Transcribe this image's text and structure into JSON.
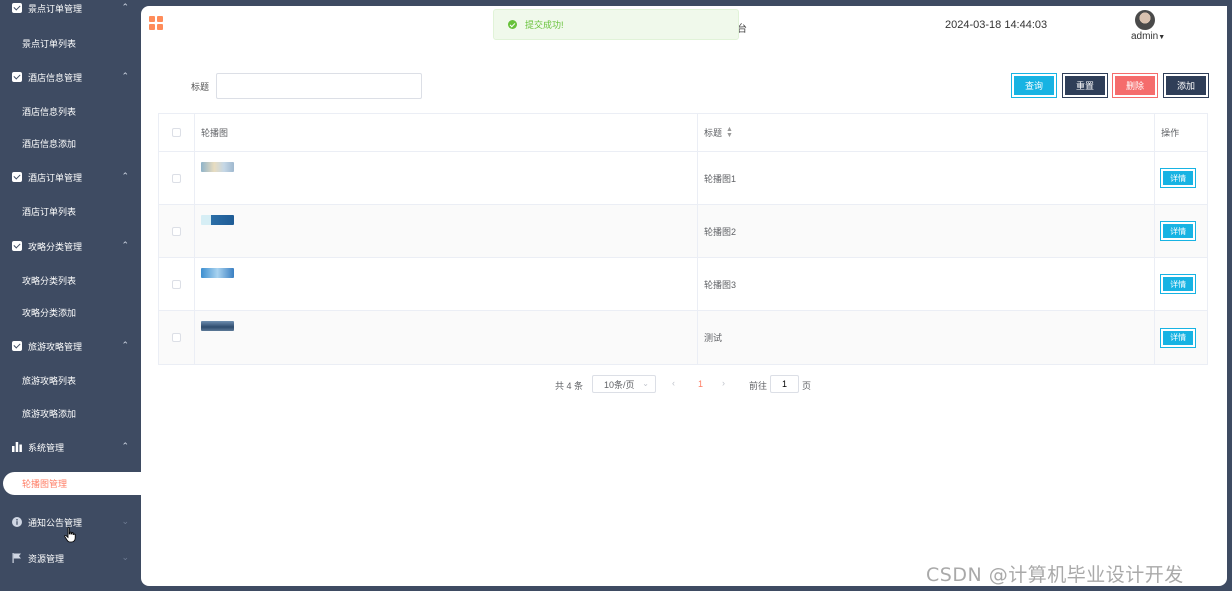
{
  "sidebar": {
    "groups": [
      {
        "label": "景点订单管理",
        "icon": "checkbox-icon"
      },
      {
        "label": "酒店信息管理",
        "icon": "checkbox-icon"
      },
      {
        "label": "酒店订单管理",
        "icon": "checkbox-icon"
      },
      {
        "label": "攻略分类管理",
        "icon": "checkbox-icon"
      },
      {
        "label": "旅游攻略管理",
        "icon": "checkbox-icon"
      },
      {
        "label": "系统管理",
        "icon": "bar-chart-icon"
      },
      {
        "label": "通知公告管理",
        "icon": "info-icon"
      },
      {
        "label": "资源管理",
        "icon": "flag-icon"
      }
    ],
    "items": [
      {
        "label": "景点订单列表"
      },
      {
        "label": "酒店信息列表"
      },
      {
        "label": "酒店信息添加"
      },
      {
        "label": "酒店订单列表"
      },
      {
        "label": "攻略分类列表"
      },
      {
        "label": "攻略分类添加"
      },
      {
        "label": "旅游攻略列表"
      },
      {
        "label": "旅游攻略添加"
      }
    ],
    "active_item": "轮播图管理"
  },
  "header": {
    "toast": "提交成功!",
    "title_tail": "台",
    "datetime": "2024-03-18 14:44:03",
    "user": "admin"
  },
  "search": {
    "label": "标题",
    "value": "",
    "buttons": {
      "query": "查询",
      "reset": "重置",
      "delete": "删除",
      "add": "添加"
    }
  },
  "table": {
    "headers": {
      "image": "轮播图",
      "title": "标题",
      "action": "操作"
    },
    "rows": [
      {
        "title": "轮播图1",
        "action": "详情"
      },
      {
        "title": "轮播图2",
        "action": "详情"
      },
      {
        "title": "轮播图3",
        "action": "详情"
      },
      {
        "title": "测试",
        "action": "详情"
      }
    ]
  },
  "pagination": {
    "total": "共 4 条",
    "page_size": "10条/页",
    "current_page": "1",
    "goto_label": "前往",
    "goto_value": "1",
    "page_suffix": "页"
  },
  "watermark": "CSDN @计算机毕业设计开发",
  "colors": {
    "sidebar": "#3e4b62",
    "accent": "#17b3e3",
    "active": "#ff7d64",
    "danger": "#f56c6c"
  }
}
